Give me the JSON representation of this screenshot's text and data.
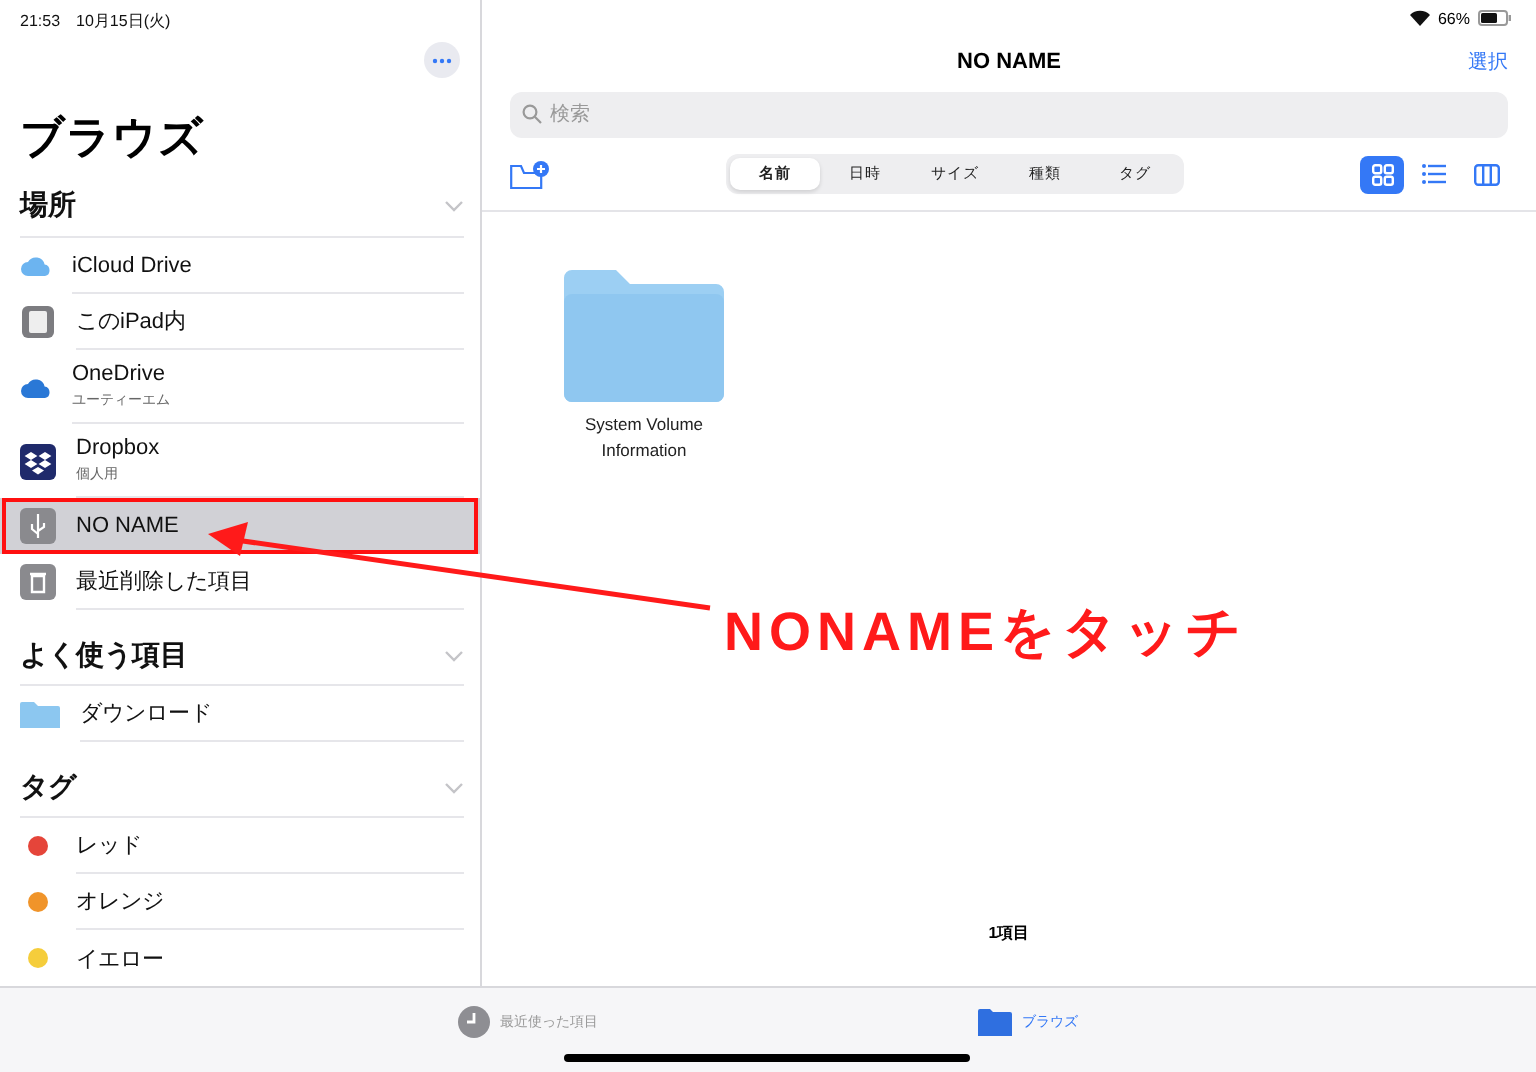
{
  "status_bar": {
    "time": "21:53",
    "date": "10月15日(火)",
    "battery": "66%"
  },
  "sidebar": {
    "title": "ブラウズ",
    "sections": [
      {
        "title": "場所",
        "expanded": true,
        "items": [
          {
            "kind": "icloud",
            "label": "iCloud Drive",
            "selected": false
          },
          {
            "kind": "ipad",
            "label": "このiPad内",
            "selected": false
          },
          {
            "kind": "onedrive",
            "label": "OneDrive",
            "subtitle": "ユーティーエム",
            "selected": false
          },
          {
            "kind": "dropbox",
            "label": "Dropbox",
            "subtitle": "個人用",
            "selected": false
          },
          {
            "kind": "usb",
            "label": "NO NAME",
            "selected": true
          },
          {
            "kind": "trash",
            "label": "最近削除した項目",
            "selected": false
          }
        ]
      },
      {
        "title": "よく使う項目",
        "expanded": true,
        "items": [
          {
            "kind": "folder",
            "label": "ダウンロード",
            "selected": false
          }
        ]
      },
      {
        "title": "タグ",
        "expanded": true,
        "items": [
          {
            "kind": "tag",
            "label": "レッド",
            "color": "#e5453a",
            "selected": false
          },
          {
            "kind": "tag",
            "label": "オレンジ",
            "color": "#f0942a",
            "selected": false
          },
          {
            "kind": "tag",
            "label": "イエロー",
            "color": "#f5cd3b",
            "selected": false
          }
        ]
      }
    ]
  },
  "main": {
    "title": "NO NAME",
    "select_button": "選択",
    "search": {
      "placeholder": "検索"
    },
    "sort_options": [
      {
        "label": "名前",
        "selected": true
      },
      {
        "label": "日時",
        "selected": false
      },
      {
        "label": "サイズ",
        "selected": false
      },
      {
        "label": "種類",
        "selected": false
      },
      {
        "label": "タグ",
        "selected": false
      }
    ],
    "view_modes": [
      {
        "kind": "grid",
        "selected": true
      },
      {
        "kind": "list",
        "selected": false
      },
      {
        "kind": "columns",
        "selected": false
      }
    ],
    "files": [
      {
        "name": "System Volume Information"
      }
    ],
    "item_count": "1項目"
  },
  "tab_bar": [
    {
      "kind": "recents",
      "label": "最近使った項目",
      "selected": false
    },
    {
      "kind": "browse",
      "label": "ブラウズ",
      "selected": true
    }
  ],
  "annotation": {
    "text": "NONAMEをタッチ"
  }
}
